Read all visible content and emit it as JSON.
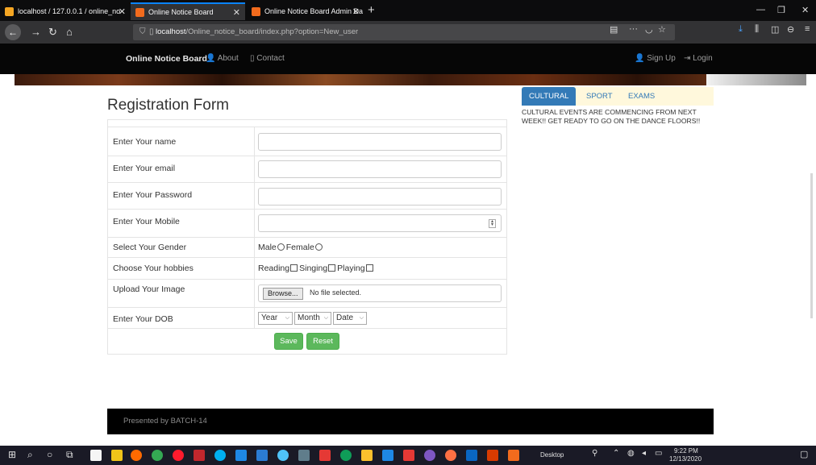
{
  "browser": {
    "tabs": [
      {
        "title": "localhost / 127.0.0.1 / online_no",
        "color": "#f5a623",
        "active": false
      },
      {
        "title": "Online Notice Board",
        "color": "#f26b1d",
        "active": true
      },
      {
        "title": "Online Notice Board Admin Da",
        "color": "#f26b1d",
        "active": false
      }
    ],
    "url_host": "localhost",
    "url_path": "/Online_notice_board/index.php?option=New_user",
    "url_menu": "···"
  },
  "site": {
    "brand": "Online Notice Board",
    "nav": {
      "about": "About",
      "contact": "Contact",
      "signup": "Sign Up",
      "login": "Login"
    }
  },
  "form": {
    "title": "Registration Form",
    "labels": {
      "name": "Enter Your name",
      "email": "Enter Your email",
      "password": "Enter Your Password",
      "mobile": "Enter Your Mobile",
      "gender": "Select Your Gender",
      "hobbies": "Choose Your hobbies",
      "image": "Upload Your Image",
      "dob": "Enter Your DOB"
    },
    "gender_options": {
      "male": "Male",
      "female": "Female"
    },
    "hobby_options": {
      "reading": "Reading",
      "singing": "Singing",
      "playing": "Playing"
    },
    "file": {
      "browse": "Browse...",
      "status": "No file selected."
    },
    "dob": {
      "year": "Year",
      "month": "Month",
      "date": "Date"
    },
    "buttons": {
      "save": "Save",
      "reset": "Reset"
    }
  },
  "notices": {
    "tabs": {
      "cultural": "CULTURAL",
      "sport": "SPORT",
      "exams": "EXAMS"
    },
    "active_tab": "cultural",
    "text": "CULTURAL EVENTS ARE COMMENCING FROM NEXT WEEK!! GET READY TO GO ON THE DANCE FLOORS!!"
  },
  "footer": {
    "text": "Presented by BATCH-14"
  },
  "taskbar": {
    "desktop": "Desktop",
    "time": "9:22 PM",
    "date": "12/13/2020"
  },
  "colors": {
    "primary": "#337ab7",
    "success": "#5cb85c",
    "notice_bg": "#fff8dc",
    "navbar": "#060606"
  }
}
